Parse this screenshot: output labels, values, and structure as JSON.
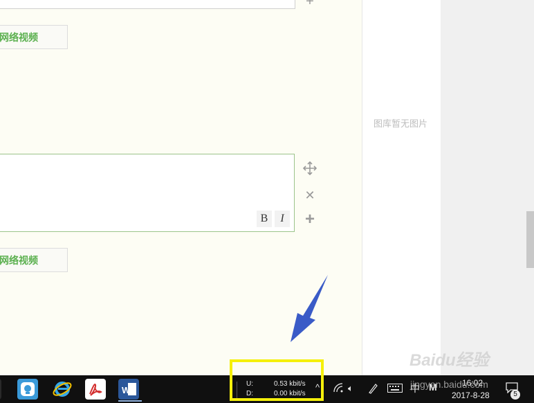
{
  "editor": {
    "video_button_label": "加网络视频",
    "bold_label": "B",
    "italic_label": "I",
    "move_icon": "move-icon",
    "close_icon": "close-icon",
    "add_icon": "plus-icon"
  },
  "sidebar": {
    "empty_text": "图库暂无图片"
  },
  "taskbar": {
    "icons": [
      "input-method-icon",
      "ie-icon",
      "pdf-icon",
      "word-icon"
    ],
    "network": {
      "upload_label": "U:",
      "upload_value": "0.53 kbit/s",
      "download_label": "D:",
      "download_value": "0.00 kbit/s"
    },
    "ime_label": "中",
    "m_label": "M",
    "time": "16:02",
    "date": "2017-8-28",
    "notification_count": "5"
  },
  "watermark": {
    "logo": "Baidu经验",
    "url": "jingyan.baidu.com"
  },
  "colors": {
    "highlight": "#f5f00b",
    "arrow": "#3a5bc7",
    "accent_green": "#5bb04f"
  }
}
